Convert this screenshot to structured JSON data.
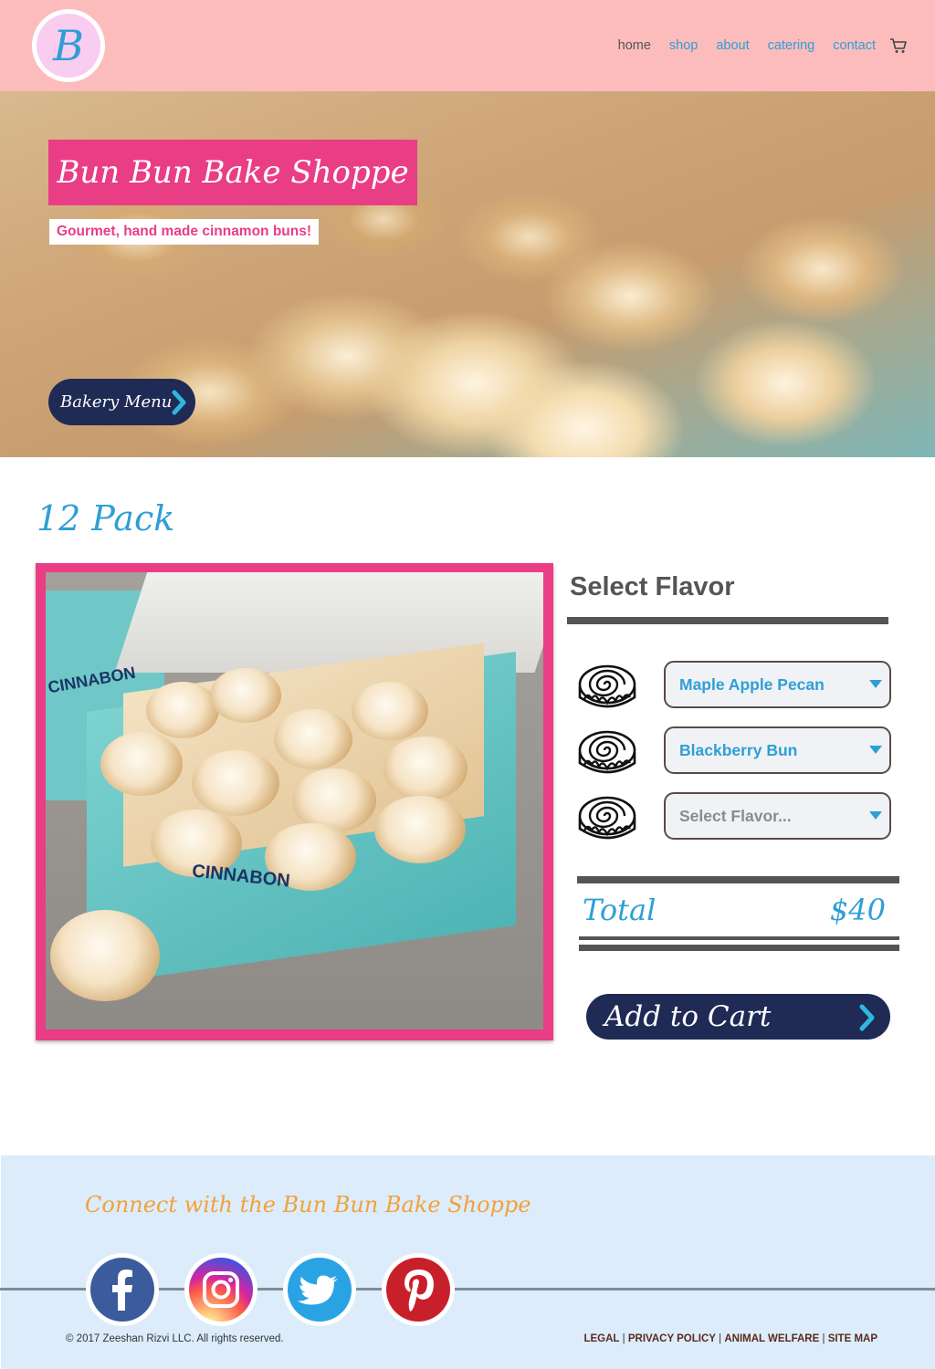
{
  "header": {
    "logo_letter": "B",
    "nav": [
      {
        "label": "home"
      },
      {
        "label": "shop"
      },
      {
        "label": "about"
      },
      {
        "label": "catering"
      },
      {
        "label": "contact"
      }
    ]
  },
  "hero": {
    "title": "Bun Bun Bake Shoppe",
    "subtitle": "Gourmet, hand made cinnamon buns!",
    "menu_button": "Bakery Menu"
  },
  "product": {
    "title": "12 Pack",
    "image_brand_text": "CINNABON",
    "select_heading": "Select Flavor",
    "flavors": [
      {
        "value": "Maple Apple Pecan"
      },
      {
        "value": "Blackberry Bun"
      },
      {
        "value": "Select Flavor..."
      }
    ],
    "total_label": "Total",
    "total_value": "$40",
    "add_to_cart": "Add to Cart"
  },
  "footer": {
    "connect_text": "Connect with the Bun Bun Bake Shoppe",
    "social": [
      {
        "icon": "facebook-icon",
        "color": "#3b5b9c"
      },
      {
        "icon": "instagram-icon",
        "color": "#d6307d"
      },
      {
        "icon": "twitter-icon",
        "color": "#2aa3e4"
      },
      {
        "icon": "pinterest-icon",
        "color": "#c8202a"
      }
    ],
    "copyright": "© 2017 Zeeshan Rizvi LLC. All rights reserved.",
    "links": [
      {
        "label": "LEGAL"
      },
      {
        "label": "PRIVACY POLICY"
      },
      {
        "label": "ANIMAL WELFARE"
      },
      {
        "label": "SITE MAP"
      }
    ],
    "separator": "|"
  },
  "colors": {
    "header_bg": "#fdbcbc",
    "accent_pink": "#e93d85",
    "accent_blue": "#2e9fd6",
    "navy": "#1f2a55",
    "footer_bg": "#dcecfb",
    "footer_heading": "#f2a23a"
  }
}
